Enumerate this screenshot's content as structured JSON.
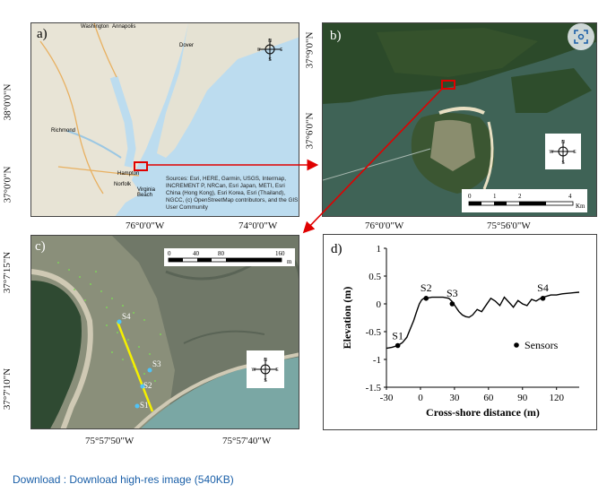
{
  "panel_a": {
    "label": "a)",
    "lat_ticks": [
      "38°0'0\"N",
      "37°0'0\"N"
    ],
    "lon_ticks": [
      "76°0'0\"W",
      "74°0'0\"W"
    ],
    "places": [
      "Washington",
      "Annapolis",
      "Dover",
      "Richmond",
      "Hampton",
      "Norfolk",
      "Virginia Beach"
    ],
    "sources": "Sources: Esri, HERE, Garmin, USGS, Intermap, INCREMENT P, NRCan, Esri Japan, METI, Esri China (Hong Kong), Esri Korea, Esri (Thailand), NGCC, (c) OpenStreetMap contributors, and the GIS User Community"
  },
  "panel_b": {
    "label": "b)",
    "lat_ticks": [
      "37°9'0\"N",
      "37°6'0\"N"
    ],
    "lon_ticks": [
      "76°0'0\"W",
      "75°56'0\"W"
    ],
    "scale_ticks": [
      "0",
      "1",
      "2",
      "4"
    ],
    "scale_unit": "Km"
  },
  "panel_c": {
    "label": "c)",
    "lat_ticks": [
      "37°7'15\"N",
      "37°7'10\"N"
    ],
    "lon_ticks": [
      "75°57'50\"W",
      "75°57'40\"W"
    ],
    "scale_ticks": [
      "0",
      "40",
      "80",
      "160"
    ],
    "scale_unit": "m",
    "sensors": [
      "S1",
      "S2",
      "S3",
      "S4"
    ]
  },
  "compass": {
    "n": "N",
    "s": "S",
    "e": "E",
    "w": "W"
  },
  "chart_data": {
    "type": "line",
    "panel_label": "d)",
    "xlabel": "Cross-shore distance (m)",
    "ylabel": "Elevation (m)",
    "xlim": [
      -30,
      140
    ],
    "ylim": [
      -1.5,
      1
    ],
    "x_ticks": [
      -30,
      0,
      30,
      60,
      90,
      120
    ],
    "y_ticks": [
      1,
      0.5,
      0,
      -0.5,
      -1,
      -1.5
    ],
    "legend": "Sensors",
    "profile": {
      "x": [
        -30,
        -25,
        -20,
        -16,
        -12,
        -9,
        -6,
        -3,
        -1,
        1,
        3,
        5,
        10,
        15,
        20,
        25,
        28,
        31,
        34,
        37,
        40,
        43,
        46,
        50,
        54,
        58,
        62,
        66,
        70,
        74,
        78,
        82,
        86,
        90,
        94,
        98,
        102,
        106,
        110,
        115,
        120,
        125,
        130,
        135,
        140
      ],
      "y": [
        -0.8,
        -0.78,
        -0.75,
        -0.7,
        -0.6,
        -0.45,
        -0.3,
        -0.12,
        0.0,
        0.07,
        0.1,
        0.1,
        0.12,
        0.12,
        0.12,
        0.1,
        0.04,
        -0.05,
        -0.14,
        -0.2,
        -0.23,
        -0.24,
        -0.2,
        -0.1,
        -0.14,
        -0.02,
        0.1,
        0.05,
        -0.03,
        0.12,
        0.03,
        -0.06,
        0.06,
        0.0,
        -0.03,
        0.08,
        0.05,
        0.1,
        0.13,
        0.16,
        0.16,
        0.18,
        0.19,
        0.2,
        0.21
      ]
    },
    "sensors": [
      {
        "name": "S1",
        "x": -20,
        "y": -0.75
      },
      {
        "name": "S2",
        "x": 5,
        "y": 0.1
      },
      {
        "name": "S3",
        "x": 28,
        "y": 0.0
      },
      {
        "name": "S4",
        "x": 108,
        "y": 0.1
      }
    ]
  },
  "footer": {
    "download": "Download : Download high-res image (540KB)"
  }
}
